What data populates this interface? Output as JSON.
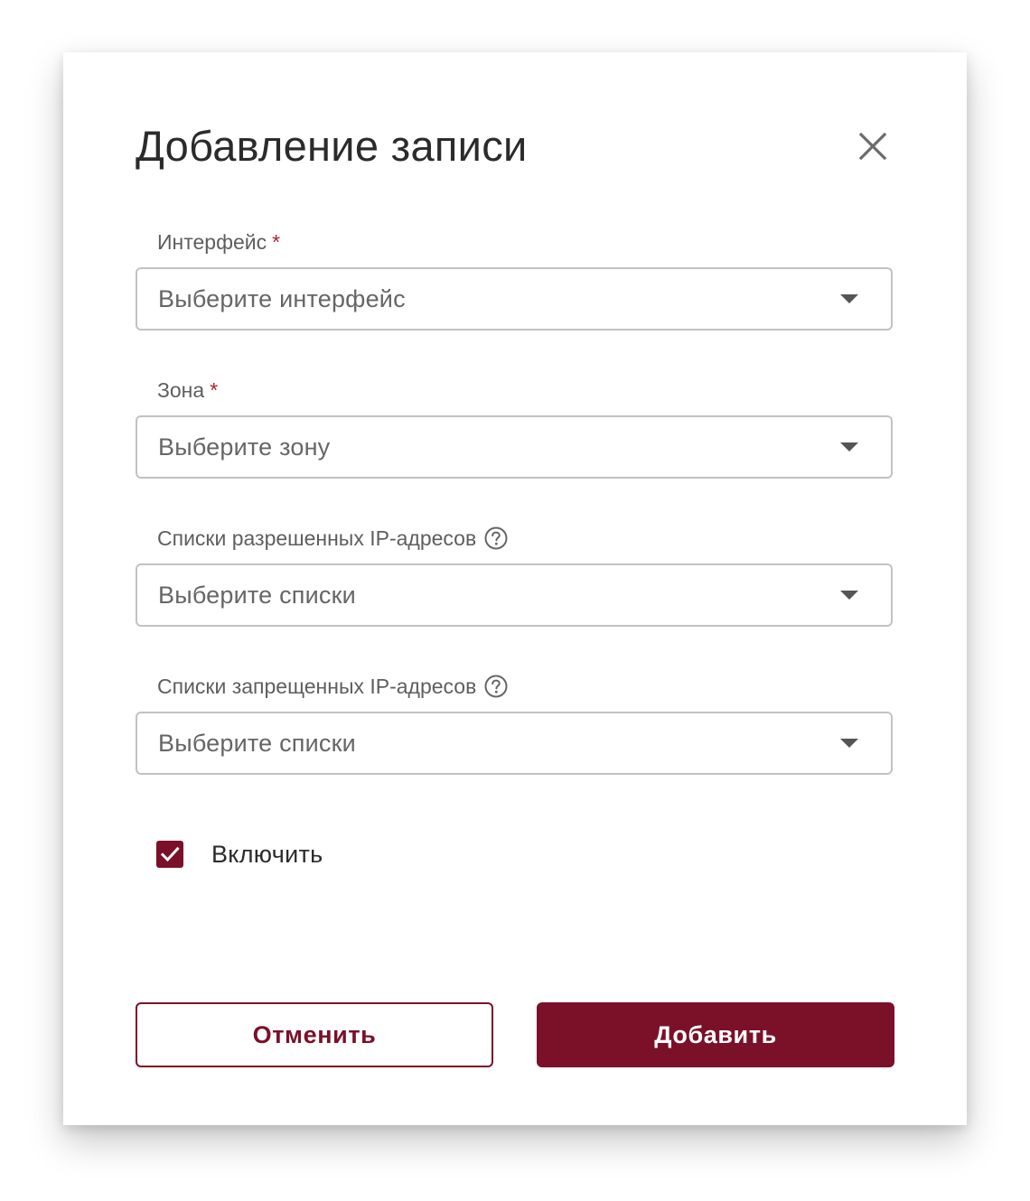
{
  "dialog": {
    "title": "Добавление записи",
    "close_icon": "close-icon"
  },
  "fields": {
    "interface": {
      "label": "Интерфейс",
      "required_mark": "*",
      "placeholder": "Выберите интерфейс"
    },
    "zone": {
      "label": "Зона",
      "required_mark": "*",
      "placeholder": "Выберите зону"
    },
    "allowed_ip_lists": {
      "label": "Списки разрешенных IP-адресов",
      "help_icon": "help-circle-icon",
      "placeholder": "Выберите списки"
    },
    "denied_ip_lists": {
      "label": "Списки запрещенных IP-адресов",
      "help_icon": "help-circle-icon",
      "placeholder": "Выберите списки"
    }
  },
  "enable": {
    "label": "Включить",
    "checked": true
  },
  "actions": {
    "cancel_label": "Отменить",
    "add_label": "Добавить"
  },
  "colors": {
    "accent": "#7b1029",
    "required": "#b41f2e",
    "border": "#c2c2c2"
  }
}
